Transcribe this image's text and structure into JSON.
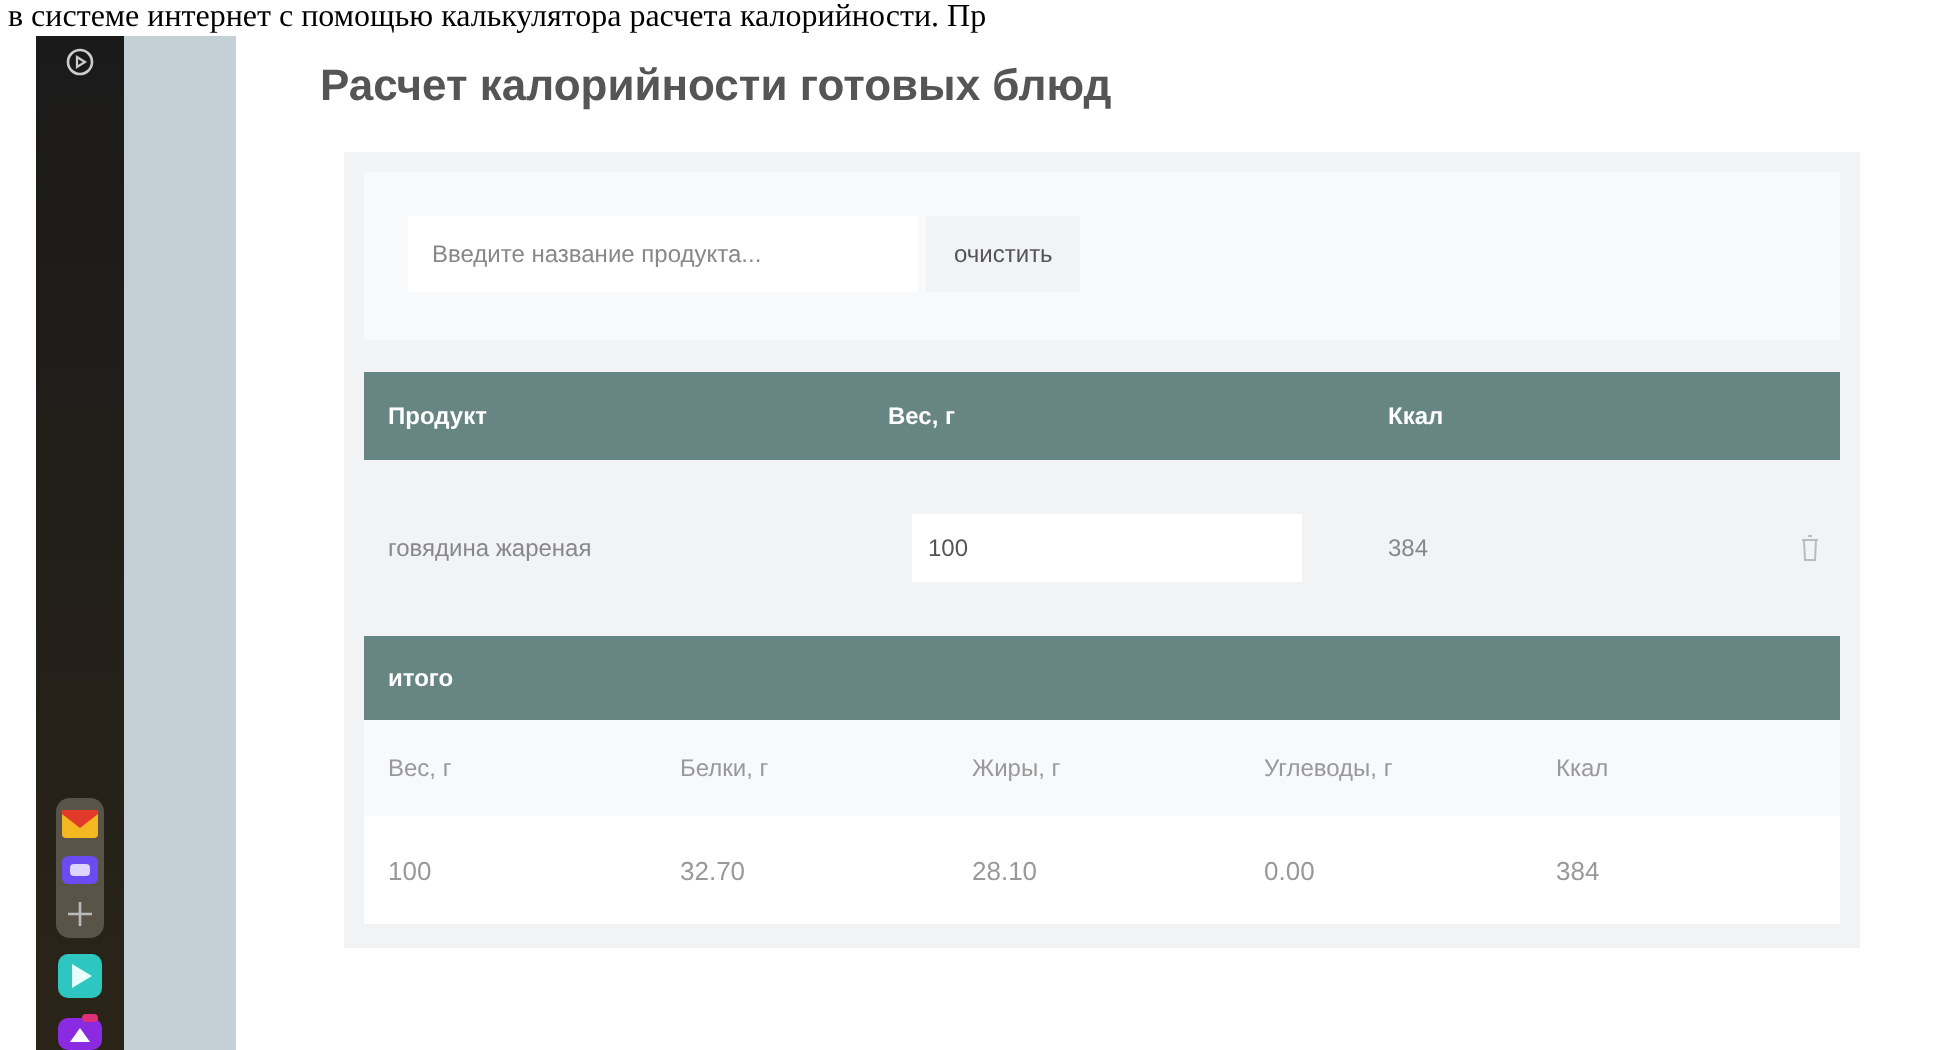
{
  "document_text": "в системе интернет с помощью калькулятора расчета калорийности. Пр",
  "page": {
    "title": "Расчет калорийности готовых блюд",
    "search": {
      "placeholder": "Введите название продукта...",
      "button": "очистить"
    },
    "table": {
      "columns": [
        "Продукт",
        "Вес, г",
        "Ккал"
      ],
      "rows": [
        {
          "product": "говядина жареная",
          "weight": "100",
          "kcal": "384"
        }
      ]
    },
    "total": {
      "title": "итого",
      "columns": [
        "Вес, г",
        "Белки, г",
        "Жиры, г",
        "Углеводы, г",
        "Ккал"
      ],
      "values": [
        "100",
        "32.70",
        "28.10",
        "0.00",
        "384"
      ]
    }
  }
}
